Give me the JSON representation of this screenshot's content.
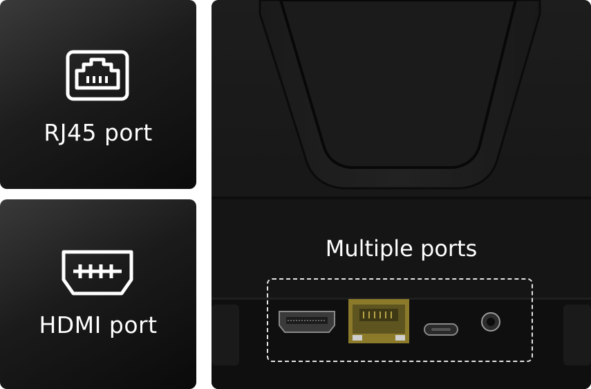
{
  "cards": [
    {
      "label": "RJ45 port",
      "icon": "ethernet-port-icon"
    },
    {
      "label": "HDMI port",
      "icon": "hdmi-port-icon"
    }
  ],
  "photo": {
    "title": "Multiple ports",
    "ports": [
      "hdmi-port",
      "rj45-port",
      "usb-c-port",
      "dc-power-jack"
    ]
  },
  "colors": {
    "card_dark": "#141414",
    "text": "#ffffff",
    "rj45_gold": "#a08a2c"
  }
}
